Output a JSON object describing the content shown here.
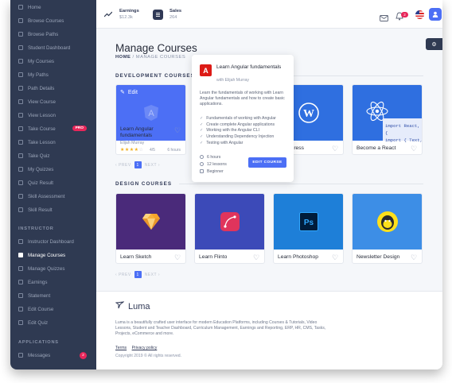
{
  "sidebar": {
    "student_items": [
      {
        "label": "Home"
      },
      {
        "label": "Browse Courses"
      },
      {
        "label": "Browse Paths"
      },
      {
        "label": "Student Dashboard"
      },
      {
        "label": "My Courses"
      },
      {
        "label": "My Paths"
      },
      {
        "label": "Path Details"
      },
      {
        "label": "View Course"
      },
      {
        "label": "View Lesson"
      },
      {
        "label": "Take Course",
        "badge": "PRO"
      },
      {
        "label": "Take Lesson"
      },
      {
        "label": "Take Quiz"
      },
      {
        "label": "My Quizzes"
      },
      {
        "label": "Quiz Result"
      },
      {
        "label": "Skill Assessment"
      },
      {
        "label": "Skill Result"
      }
    ],
    "instructor_heading": "INSTRUCTOR",
    "instructor_items": [
      {
        "label": "Instructor Dashboard"
      },
      {
        "label": "Manage Courses",
        "active": true
      },
      {
        "label": "Manage Quizzes"
      },
      {
        "label": "Earnings"
      },
      {
        "label": "Statement"
      },
      {
        "label": "Edit Course"
      },
      {
        "label": "Edit Quiz"
      }
    ],
    "applications_heading": "APPLICATIONS",
    "application_items": [
      {
        "label": "Messages",
        "badge": "2"
      }
    ]
  },
  "topbar": {
    "earnings": {
      "label": "Earnings",
      "value": "$12.3k"
    },
    "sales": {
      "label": "Sales",
      "value": "264"
    },
    "notification_count": "2"
  },
  "main": {
    "title": "Manage Courses",
    "breadcrumb_home": "HOME",
    "breadcrumb_sep": "/",
    "breadcrumb_current": "MANAGE COURSES",
    "development_heading": "DEVELOPMENT COURSES",
    "design_heading": "DESIGN COURSES",
    "pager": {
      "prev": "PREV",
      "page": "1",
      "next": "NEXT"
    }
  },
  "development_courses": [
    {
      "title": "Learn Angular fundamentals",
      "author": "Elijah Murray",
      "rating": "4/5",
      "hours": "6 hours",
      "edit_label": "Edit",
      "color": "#4c6ff5"
    },
    {
      "title": "",
      "color": "#2f6fe0"
    },
    {
      "title": "WordPress",
      "color": "#2f6fe0"
    },
    {
      "title": "Become a React",
      "color": "#2f6fe0"
    }
  ],
  "react_code_lines": [
    "import React, {",
    "import { Text,"
  ],
  "design_courses": [
    {
      "title": "Learn Sketch",
      "color": "#4a2a7a"
    },
    {
      "title": "Learn Flinto",
      "color": "#3c4ab8"
    },
    {
      "title": "Learn Photoshop",
      "color": "#1e7fd8"
    },
    {
      "title": "Newsletter Design",
      "color": "#3d8ee6"
    }
  ],
  "popover": {
    "title": "Learn Angular fundamentals",
    "author": "with Elijah Murray",
    "description": "Learn the fundamentals of working with Learn Angular fundamentals and how to create basic applications.",
    "checklist": [
      "Fundamentals of working with Angular",
      "Create complete Angular applications",
      "Working with the Angular CLI",
      "Understanding Dependency Injection",
      "Testing with Angular"
    ],
    "meta": [
      "6 hours",
      "12 lessons",
      "Beginner"
    ],
    "button": "EDIT COURSE"
  },
  "footer": {
    "brand": "Luma",
    "description": "Luma is a beautifully crafted user interface for modern Education Platforms, including Courses & Tutorials, Video Lessons, Student and Teacher Dashboard, Curriculum Management, Earnings and Reporting, ERP, HR, CMS, Tasks, Projects, eCommerce and more.",
    "terms": "Terms",
    "privacy": "Privacy policy",
    "copyright": "Copyright 2019 © All rights reserved."
  },
  "colors": {
    "sidebar": "#2f3a52",
    "accent": "#4c6ff5",
    "badge": "#e8265a"
  }
}
